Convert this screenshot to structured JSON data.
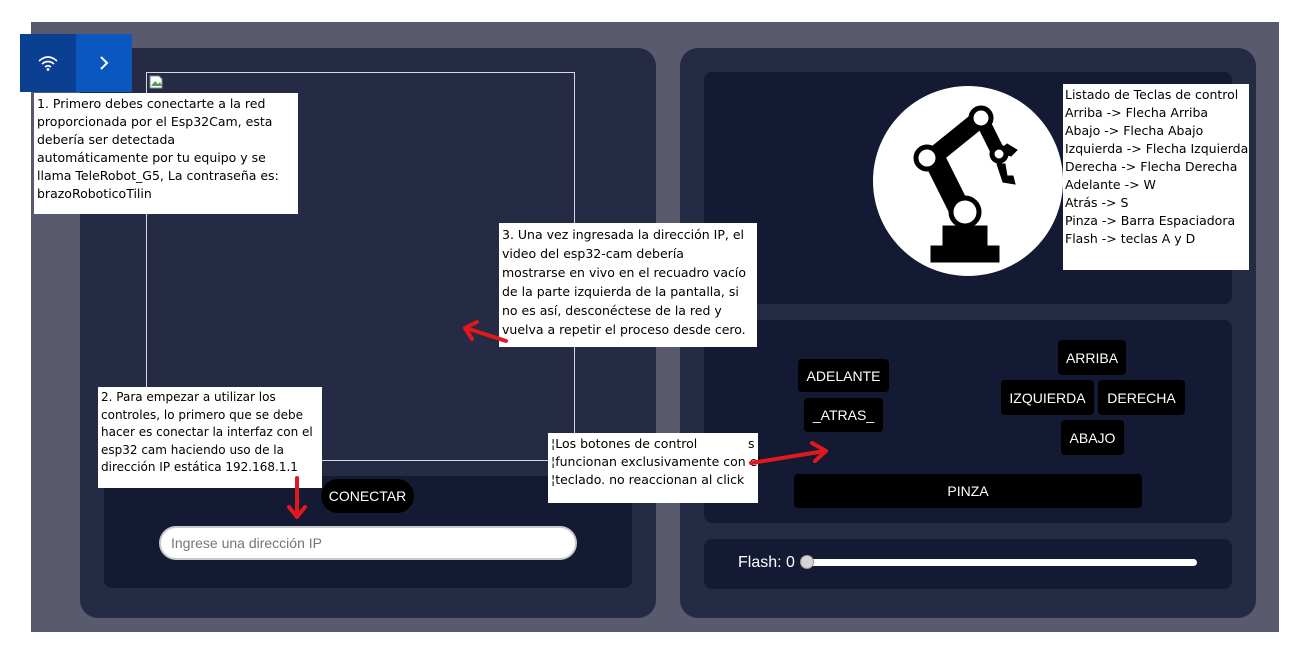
{
  "toolbar": {
    "wifi_icon": "wifi-icon",
    "next_icon": "chevron-right-icon"
  },
  "left_panel": {
    "connect_button": "CONECTAR",
    "ip_input": {
      "placeholder": "Ingrese una dirección IP",
      "value": ""
    }
  },
  "right_panel": {
    "logo_icon": "robot-arm-icon",
    "keys_title": "Listado de Teclas de control",
    "keys": [
      "Arriba -> Flecha Arriba",
      "Abajo -> Flecha Abajo",
      "Izquierda -> Flecha Izquierda",
      "Derecha -> Flecha Derecha",
      "Adelante -> W",
      "Atrás -> S",
      "Pinza -> Barra Espaciadora",
      "Flash -> teclas A y D"
    ],
    "controls": {
      "adelante": "ADELANTE",
      "atras": "_ATRAS_",
      "arriba": "ARRIBA",
      "izquierda": "IZQUIERDA",
      "derecha": "DERECHA",
      "abajo": "ABAJO",
      "pinza": "PINZA"
    },
    "flash": {
      "label": "Flash: 0",
      "value": 0
    }
  },
  "annotations": {
    "note1": [
      "1. Primero debes conectarte a la red",
      "proporcionada por el Esp32Cam, esta",
      "debería ser detectada",
      "automáticamente por tu equipo y se",
      "llama TeleRobot_G5, La contraseña es:",
      "brazoRoboticoTilin"
    ],
    "note2": [
      "2. Para empezar a utilizar los",
      "controles, lo primero que se debe",
      "hacer es conectar la interfaz con el",
      "esp32 cam haciendo uso de la",
      "dirección IP estática 192.168.1.1"
    ],
    "note3": [
      "3. Una vez ingresada la dirección IP, el",
      "video del esp32-cam debería",
      "mostrarse en vivo en el recuadro vacío",
      "de la parte izquierda de la pantalla, si",
      "no es así, desconéctese de la red y",
      "vuelva a repetir el proceso desde cero."
    ],
    "note4": [
      "¦Los botones de control",
      "¦funcionan exclusivamente con el",
      "¦teclado. no reaccionan al click"
    ],
    "note4_stray": "s"
  },
  "colors": {
    "arrow": "#e0191f",
    "panel": "#252a45",
    "inner": "#141a33",
    "accent": "#0b57c0"
  }
}
